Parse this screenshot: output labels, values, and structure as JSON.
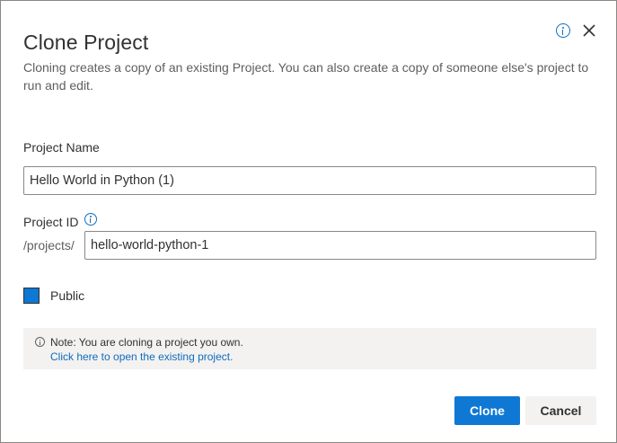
{
  "dialog": {
    "title": "Clone Project",
    "subtitle": "Cloning creates a copy of an existing Project. You can also create a copy of someone else's project to run and edit.",
    "info_icon": "info-icon",
    "close_icon": "close-icon"
  },
  "form": {
    "project_name_label": "Project Name",
    "project_name_value": "Hello World in Python (1)",
    "project_id_label": "Project ID",
    "project_id_prefix": "/projects/",
    "project_id_value": "hello-world-python-1",
    "public_label": "Public",
    "public_checked": true
  },
  "note": {
    "text": "Note: You are cloning a project you own.",
    "link": "Click here to open the existing project."
  },
  "buttons": {
    "clone": "Clone",
    "cancel": "Cancel"
  },
  "colors": {
    "accent": "#0f78d4",
    "link": "#0f6cbd",
    "note_background": "#f3f2f1"
  }
}
